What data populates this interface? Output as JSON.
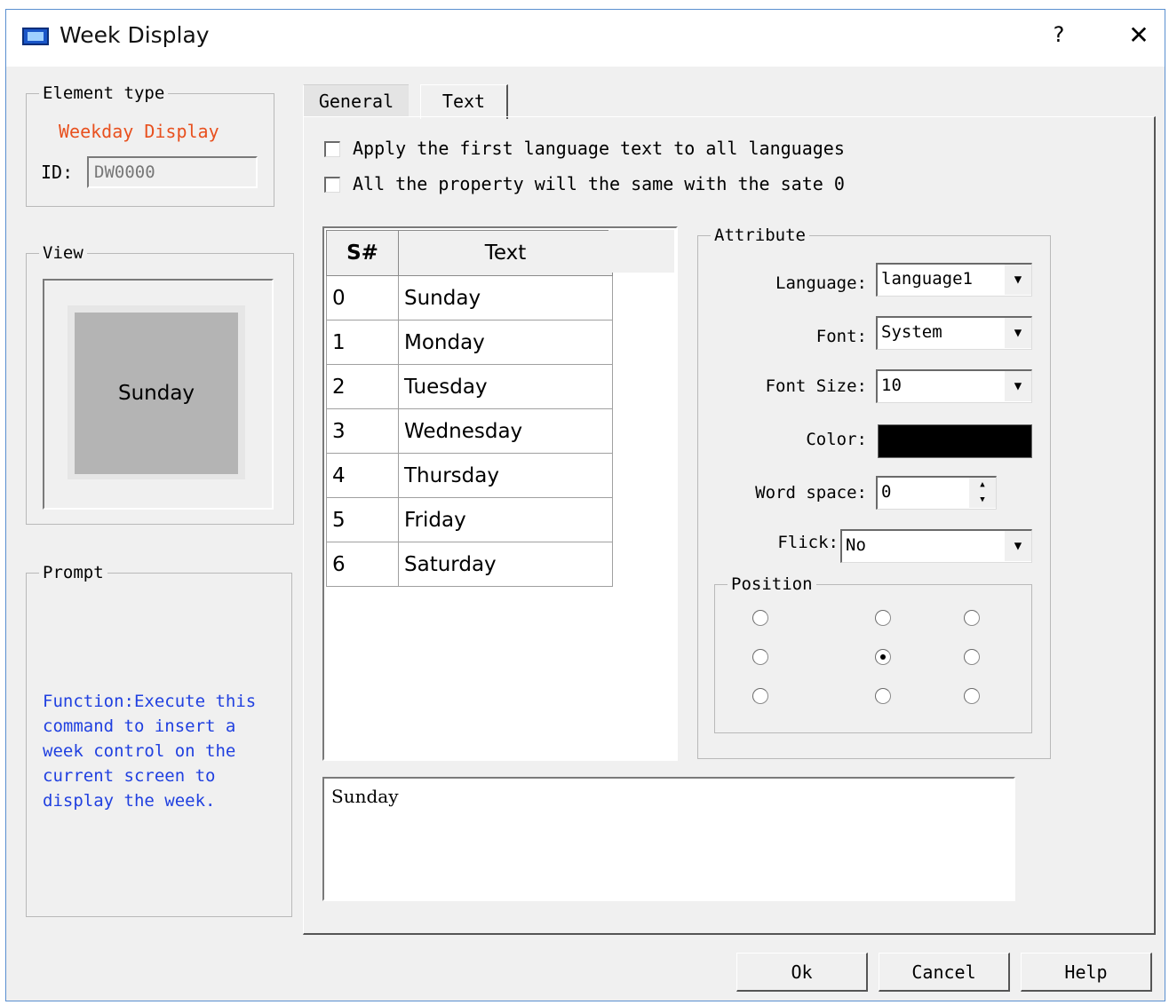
{
  "window": {
    "title": "Week Display",
    "help": "?",
    "close": "✕"
  },
  "element_type": {
    "legend": "Element type",
    "name": "Weekday Display",
    "id_label": "ID:",
    "id_value": "DW0000"
  },
  "view": {
    "legend": "View",
    "preview_text": "Sunday"
  },
  "prompt": {
    "legend": "Prompt",
    "lines": [
      "Function:Execute this",
      "command to insert a",
      "week control on the",
      "current screen to",
      "display the week."
    ]
  },
  "tabs": [
    "General",
    "Text"
  ],
  "options": {
    "apply_first_language": "Apply the first language text to all languages",
    "same_property": "All the property will the same with the sate 0"
  },
  "grid": {
    "headers": [
      "S#",
      "Text"
    ],
    "rows": [
      [
        "0",
        "Sunday"
      ],
      [
        "1",
        "Monday"
      ],
      [
        "2",
        "Tuesday"
      ],
      [
        "3",
        "Wednesday"
      ],
      [
        "4",
        "Thursday"
      ],
      [
        "5",
        "Friday"
      ],
      [
        "6",
        "Saturday"
      ]
    ]
  },
  "attribute": {
    "legend": "Attribute",
    "language_label": "Language:",
    "language_value": "language1",
    "font_label": "Font:",
    "font_value": "System",
    "font_size_label": "Font Size:",
    "font_size_value": "10",
    "color_label": "Color:",
    "color_value": "#000000",
    "word_space_label": "Word space:",
    "word_space_value": "0",
    "flick_label": "Flick:",
    "flick_value": "No",
    "position_legend": "Position",
    "position_selected": "middle-center"
  },
  "text_preview": "Sunday",
  "buttons": {
    "ok": "Ok",
    "cancel": "Cancel",
    "help": "Help"
  },
  "colors": {
    "element_name": "#e8501e",
    "prompt_text": "#2040e0",
    "preview_face": "#b4b4b4",
    "window_border": "#5a8fd0"
  }
}
